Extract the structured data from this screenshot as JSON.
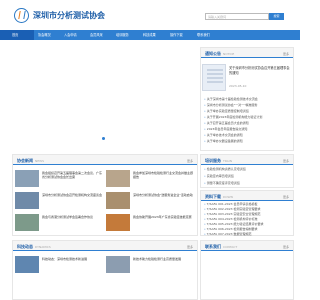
{
  "header": {
    "site_title": "深圳市分析测试协会",
    "search_placeholder": "请输入关键词",
    "search_label": "搜索"
  },
  "nav": [
    {
      "label": "首页"
    },
    {
      "label": "协会概况"
    },
    {
      "label": "入会申请"
    },
    {
      "label": "会员风采"
    },
    {
      "label": "培训服务"
    },
    {
      "label": "科技成果"
    },
    {
      "label": "操作下载"
    },
    {
      "label": "联系我们"
    }
  ],
  "notice": {
    "title": "通知公告",
    "title_en": "NOTICE",
    "more": "更多",
    "feature_text": "关于深圳市分析测试协会召开第五届理事会的通知",
    "feature_date": "2023-05-10",
    "items": [
      "关于深圳市第十届检验检测技术交流会",
      "深圳市分析测试协会\"一对一\"精准服务",
      "关于举办实验室质量控制培训班",
      "关于开展2023年度检测机构能力验证计划",
      "关于召开第五届会员大会的通知",
      "2023年会员年度报告提交通知",
      "关于举办技术交流会的通知",
      "关于举办仪器设备展的通知"
    ]
  },
  "news": {
    "title": "协会新闻",
    "title_en": "NEWS",
    "more": "更多",
    "items": [
      {
        "text": "我会组织召开第五届理事会第二次会议，广东省分析测试协会会长出席"
      },
      {
        "text": "我会参加深圳市检验检测行业交流会并做主题报告"
      },
      {
        "text": "深圳市分析测试协会召开检测机构交流座谈会"
      },
      {
        "text": "深圳市分析测试协会\"送服务进企业\"活动启动"
      },
      {
        "text": "我会与香港分析测试学会签署合作协议"
      },
      {
        "text": "我会协助开展2023年广东省实验室技能竞赛"
      }
    ]
  },
  "train": {
    "title": "培训服务",
    "title_en": "TRAIN",
    "more": "更多",
    "items": [
      "检验检测机构资质认定培训班",
      "实验室内审员培训班",
      "测量不确定度评定培训班"
    ]
  },
  "down": {
    "title": "资料下载",
    "title_en": "DOWN",
    "more": "更多",
    "items": [
      "T/SAFA 001-2023 会员申请表格模板",
      "T/SAFA 002-2023 检测实验室管理要求",
      "T/SAFA 003-2023 实验室安全管理规范",
      "T/SAFA 004-2023 检测机构评价标准",
      "T/SAFA 005-2023 能力验证结果评价要求",
      "T/SAFA 006-2023 检测报告编制要求",
      "T/SAFA 007-2023 数据管理规范"
    ]
  },
  "dynamics": {
    "title": "科技动态",
    "title_en": "DYNAMICS",
    "more": "更多",
    "items": [
      {
        "text": "科技动态：深圳市检测技术新进展"
      },
      {
        "text": "新技术助力检验检测行业高质量发展"
      }
    ]
  },
  "contact": {
    "title": "联系我们",
    "title_en": "CONTACT",
    "more": "更多"
  }
}
